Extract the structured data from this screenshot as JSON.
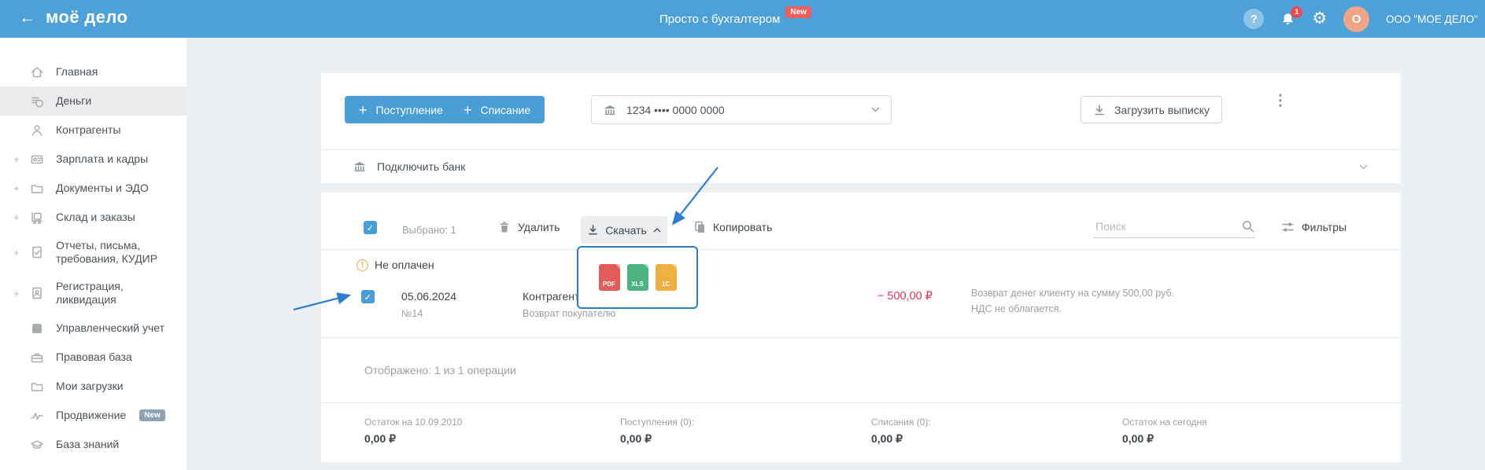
{
  "topbar": {
    "logo": "моё дело",
    "tagline": "Просто с бухгалтером",
    "new_badge": "New",
    "notification_count": "1",
    "avatar_letter": "O",
    "company": "ООО \"МОЕ ДЕЛО\""
  },
  "icons": {
    "back_arrow": "←",
    "help": "?",
    "gear": "⚙",
    "kebab": "⋮",
    "plus": "+",
    "check": "✓",
    "warning": "!",
    "ruble": "₽"
  },
  "sidebar": {
    "items": [
      {
        "label": "Главная",
        "icon": "home"
      },
      {
        "label": "Деньги",
        "icon": "money",
        "active": true
      },
      {
        "label": "Контрагенты",
        "icon": "counterparties"
      },
      {
        "label": "Зарплата и кадры",
        "icon": "salary",
        "expandable": true
      },
      {
        "label": "Документы и ЭДО",
        "icon": "documents",
        "expandable": true
      },
      {
        "label": "Склад и заказы",
        "icon": "warehouse",
        "expandable": true
      },
      {
        "label": "Отчеты, письма, требования, КУДИР",
        "icon": "reports",
        "expandable": true
      },
      {
        "label": "Регистрация, ликвидация",
        "icon": "registration",
        "expandable": true
      },
      {
        "label": "Управленческий учет",
        "icon": "management"
      },
      {
        "label": "Правовая база",
        "icon": "legal"
      },
      {
        "label": "Мои загрузки",
        "icon": "downloads"
      },
      {
        "label": "Продвижение",
        "icon": "promotion",
        "badge": "New"
      },
      {
        "label": "База знаний",
        "icon": "knowledge"
      }
    ]
  },
  "actions": {
    "income_button": "Поступление",
    "expense_button": "Списание",
    "account_select": "1234 •••• 0000 0000",
    "upload_statement": "Загрузить выписку",
    "connect_bank": "Подключить банк"
  },
  "toolbar": {
    "selected_label": "Выбрано: 1",
    "delete": "Удалить",
    "download": "Скачать",
    "copy": "Копировать",
    "search_placeholder": "Поиск",
    "filters": "Фильтры",
    "download_options": [
      "PDF",
      "XLS",
      "1C"
    ]
  },
  "operation": {
    "status": "Не оплачен",
    "date": "05.06.2024",
    "number": "№14",
    "counterparty": "Контрагент",
    "operation_type": "Возврат покупателю",
    "amount": "− 500,00 ₽",
    "description_line1": "Возврат денег клиенту на сумму 500,00 руб.",
    "description_line2": "НДС не облагается."
  },
  "footer": {
    "shown": "Отображено: 1 из 1 операции",
    "summary": [
      {
        "label": "Остаток на 10.09.2010",
        "value": "0,00 ₽"
      },
      {
        "label": "Поступления (0):",
        "value": "0,00 ₽"
      },
      {
        "label": "Списания (0):",
        "value": "0,00 ₽"
      },
      {
        "label": "Остаток на сегодня",
        "value": "0,00 ₽"
      }
    ]
  },
  "colors": {
    "topbar_blue": "#4da1d8",
    "accent_blue": "#4a9ed6",
    "amount_red": "#e0335a",
    "warning_orange": "#f0a63c",
    "new_badge_red": "#ee5f5f",
    "dropdown_border_blue": "#2b7cc9",
    "pdf_red": "#e25c5c",
    "xls_green": "#4cb381",
    "onec_amber": "#eeb041"
  }
}
